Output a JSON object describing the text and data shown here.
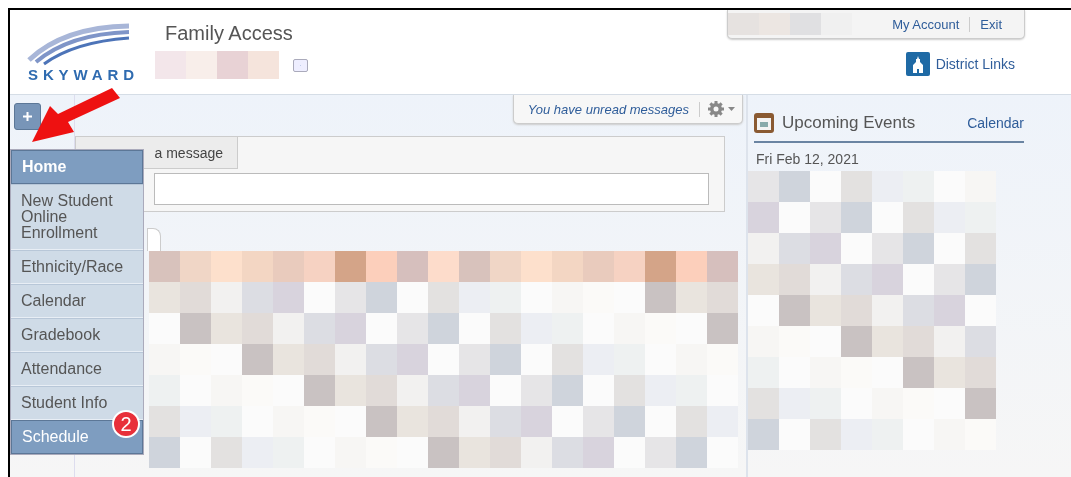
{
  "header": {
    "logo_text": "SKYWARD",
    "app_title": "Family Access",
    "account_links": [
      "My Account",
      "Exit"
    ],
    "district_links": "District Links"
  },
  "messages_bar": {
    "notice": "You have unread messages"
  },
  "message_card": {
    "tab": "a message"
  },
  "menu": [
    {
      "label": "Home",
      "selected": true,
      "current": true
    },
    {
      "label": "New Student Online Enrollment",
      "selected": false,
      "current": false
    },
    {
      "label": "Ethnicity/Race",
      "selected": false,
      "current": false
    },
    {
      "label": "Calendar",
      "selected": false,
      "current": false
    },
    {
      "label": "Gradebook",
      "selected": false,
      "current": false
    },
    {
      "label": "Attendance",
      "selected": false,
      "current": false
    },
    {
      "label": "Student Info",
      "selected": false,
      "current": false
    },
    {
      "label": "Schedule",
      "selected": true,
      "current": false,
      "badge": "2"
    }
  ],
  "upcoming_events": {
    "title": "Upcoming Events",
    "link": "Calendar",
    "date": "Fri Feb 12, 2021"
  }
}
